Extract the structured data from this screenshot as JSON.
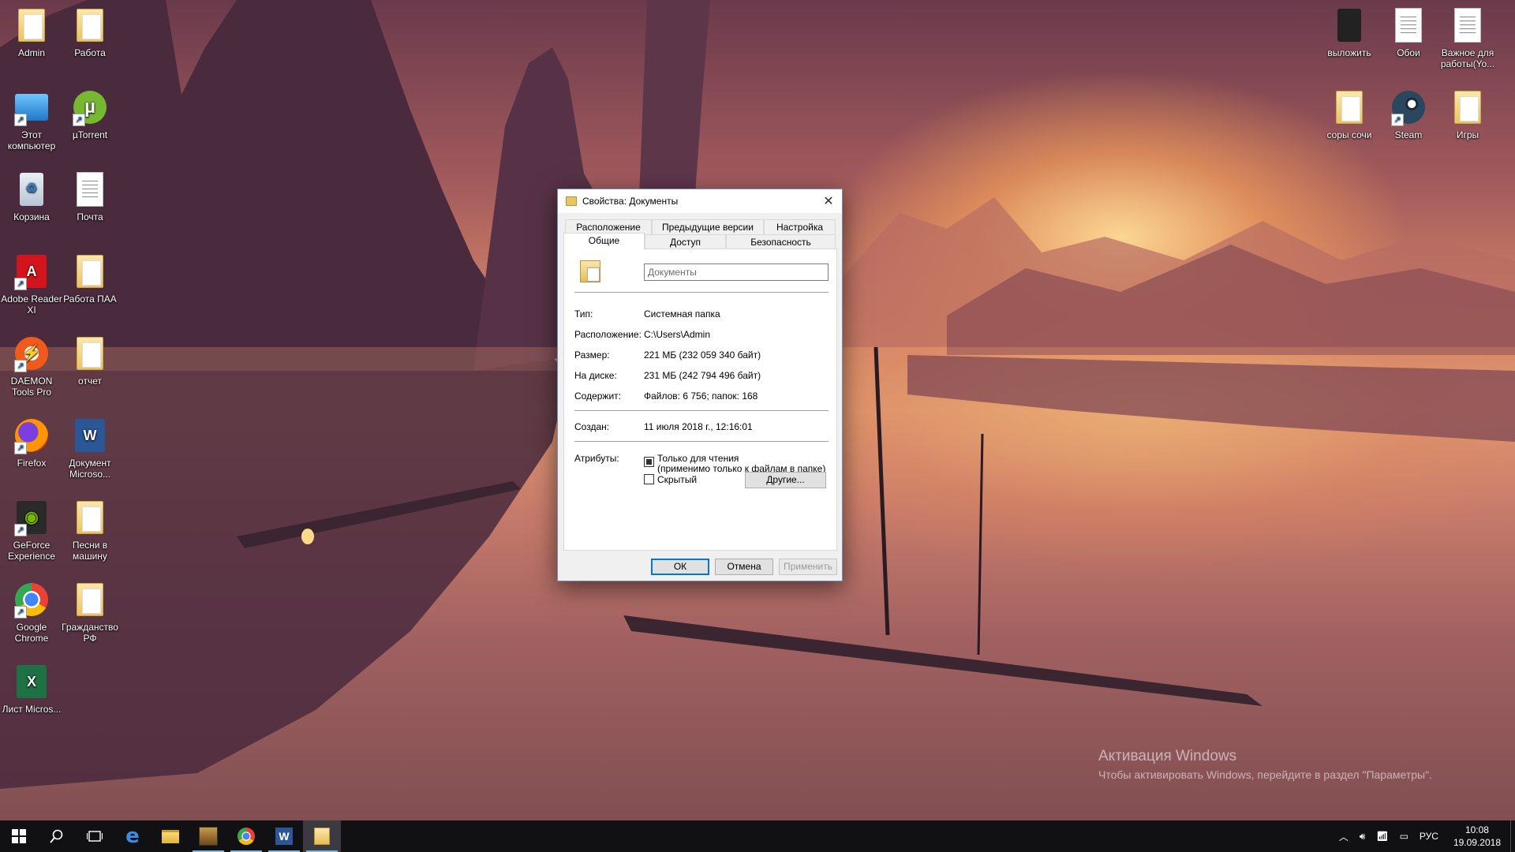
{
  "dialog": {
    "title": "Свойства: Документы",
    "close_glyph": "✕",
    "tabs_row1": [
      "Расположение",
      "Предыдущие версии",
      "Настройка"
    ],
    "tabs_row2": [
      "Общие",
      "Доступ",
      "Безопасность"
    ],
    "name_value": "Документы",
    "type_label": "Тип:",
    "type_value": "Системная папка",
    "location_label": "Расположение:",
    "location_value": "C:\\Users\\Admin",
    "size_label": "Размер:",
    "size_value": "221 МБ (232 059 340 байт)",
    "disk_label": "На диске:",
    "disk_value": "231 МБ (242 794 496 байт)",
    "contains_label": "Содержит:",
    "contains_value": "Файлов: 6 756; папок: 168",
    "created_label": "Создан:",
    "created_value": "11 июля 2018 г., 12:16:01",
    "attributes_label": "Атрибуты:",
    "readonly_line1": "Только для чтения",
    "readonly_line2": "(применимо только к файлам в папке)",
    "readonly_state": "mixed",
    "hidden_label": "Скрытый",
    "hidden_checked": false,
    "other_button": "Другие...",
    "ok_button": "ОК",
    "cancel_button": "Отмена",
    "apply_button": "Применить"
  },
  "desktop_left": [
    {
      "label": "Admin",
      "icon": "user-folder-icon"
    },
    {
      "label": "Работа",
      "icon": "folder-icon"
    },
    {
      "label": "Этот компьютер",
      "icon": "computer-icon"
    },
    {
      "label": "µTorrent",
      "icon": "utorrent-icon"
    },
    {
      "label": "Корзина",
      "icon": "recycle-bin-icon"
    },
    {
      "label": "Почта",
      "icon": "document-icon"
    },
    {
      "label": "Adobe Reader XI",
      "icon": "adobe-reader-icon"
    },
    {
      "label": "Работа ПАА",
      "icon": "folder-icon"
    },
    {
      "label": "DAEMON Tools Pro",
      "icon": "daemon-tools-icon"
    },
    {
      "label": "отчет",
      "icon": "folder-icon"
    },
    {
      "label": "Firefox",
      "icon": "firefox-icon"
    },
    {
      "label": "Документ Microso...",
      "icon": "word-document-icon"
    },
    {
      "label": "GeForce Experience",
      "icon": "geforce-icon"
    },
    {
      "label": "Песни в машину",
      "icon": "music-folder-icon"
    },
    {
      "label": "Google Chrome",
      "icon": "chrome-icon"
    },
    {
      "label": "Гражданство РФ",
      "icon": "folder-icon"
    },
    {
      "label": "Лист Micros...",
      "icon": "excel-icon"
    }
  ],
  "desktop_right": [
    {
      "label": "выложить",
      "icon": "dark-folder-icon"
    },
    {
      "label": "Обои",
      "icon": "wallpapers-folder-icon"
    },
    {
      "label": "Важное для работы(Yo...",
      "icon": "important-folder-icon"
    },
    {
      "label": "соры сочи",
      "icon": "folder-icon"
    },
    {
      "label": "Steam",
      "icon": "steam-icon"
    },
    {
      "label": "Игры",
      "icon": "games-folder-icon"
    }
  ],
  "watermark": {
    "line1": "Активация Windows",
    "line2": "Чтобы активировать Windows, перейдите в раздел \"Параметры\"."
  },
  "taskbar": {
    "language": "РУС",
    "time": "10:08",
    "date": "19.09.2018",
    "accent": "#76b9ed"
  }
}
